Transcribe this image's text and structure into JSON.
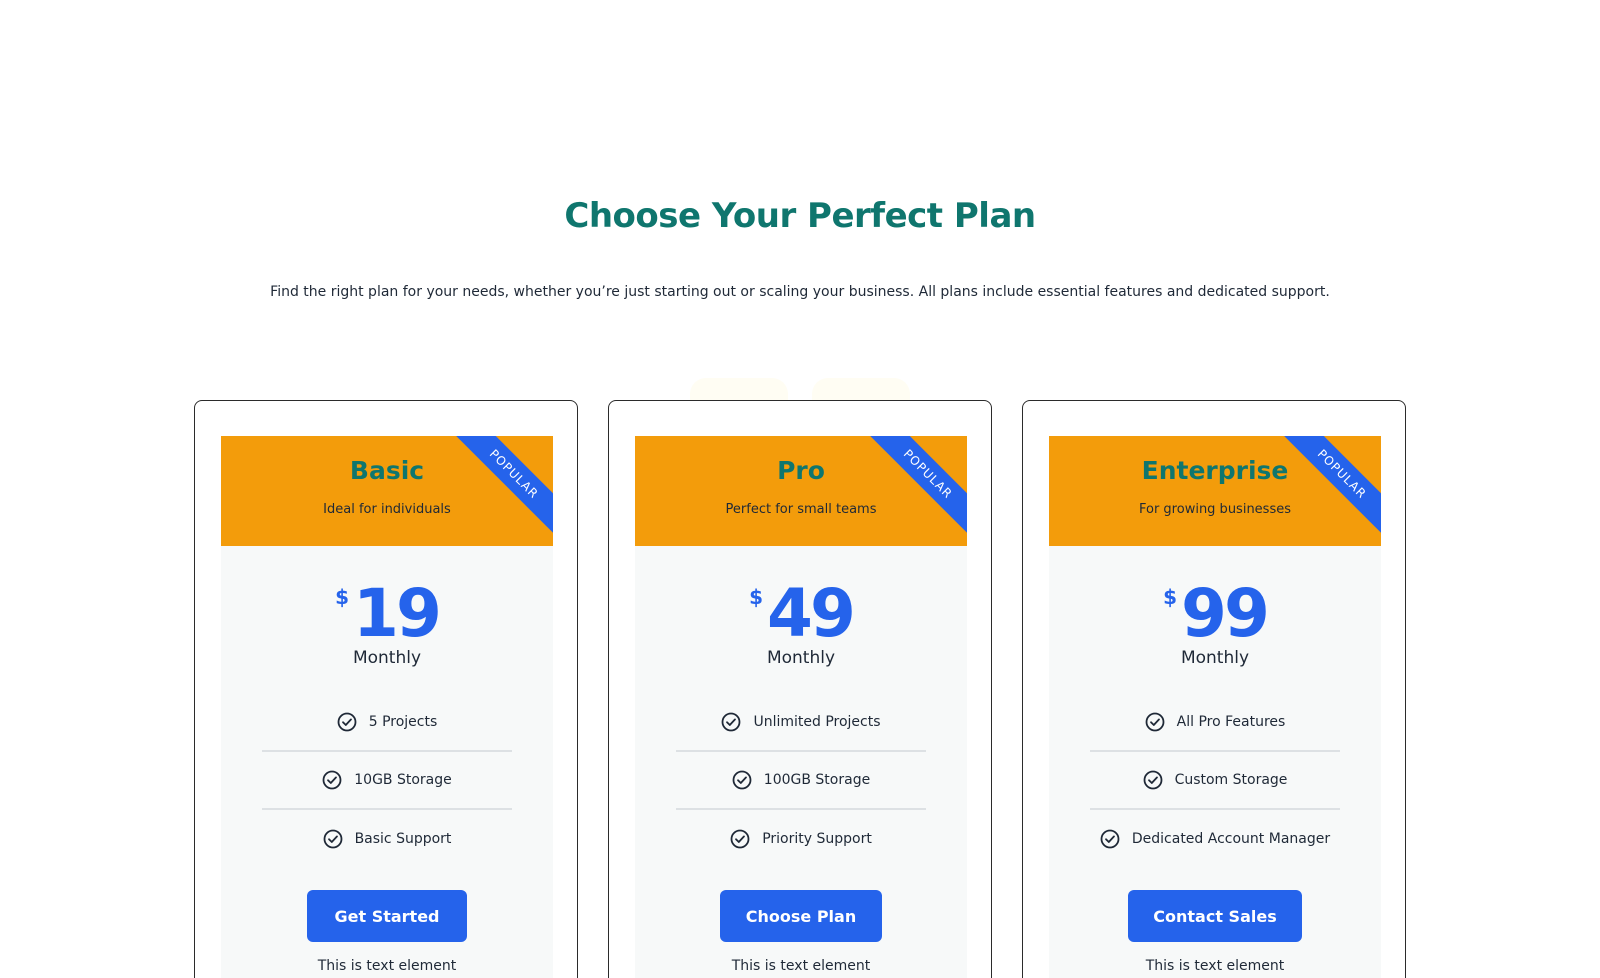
{
  "header": {
    "title": "Choose Your Perfect Plan",
    "subtitle": "Find the right plan for your needs, whether you’re just starting out or scaling your business. All plans include essential features and dedicated support."
  },
  "colors": {
    "title": "#0f766e",
    "card_header": "#f39c0b",
    "accent_blue": "#2563eb",
    "card_body": "#f7f9f9"
  },
  "plans": [
    {
      "name": "Basic",
      "description": "Ideal for individuals",
      "badge": "POPULAR",
      "currency": "$",
      "price": "19",
      "period": "Monthly",
      "features": [
        "5 Projects",
        "10GB Storage",
        "Basic Support"
      ],
      "cta": "Get Started",
      "note": "This is text element"
    },
    {
      "name": "Pro",
      "description": "Perfect for small teams",
      "badge": "POPULAR",
      "currency": "$",
      "price": "49",
      "period": "Monthly",
      "features": [
        "Unlimited Projects",
        "100GB Storage",
        "Priority Support"
      ],
      "cta": "Choose Plan",
      "note": "This is text element"
    },
    {
      "name": "Enterprise",
      "description": "For growing businesses",
      "badge": "POPULAR",
      "currency": "$",
      "price": "99",
      "period": "Monthly",
      "features": [
        "All Pro Features",
        "Custom Storage",
        "Dedicated Account Manager"
      ],
      "cta": "Contact Sales",
      "note": "This is text element"
    }
  ],
  "icons": {
    "feature": "check-circle-icon"
  }
}
